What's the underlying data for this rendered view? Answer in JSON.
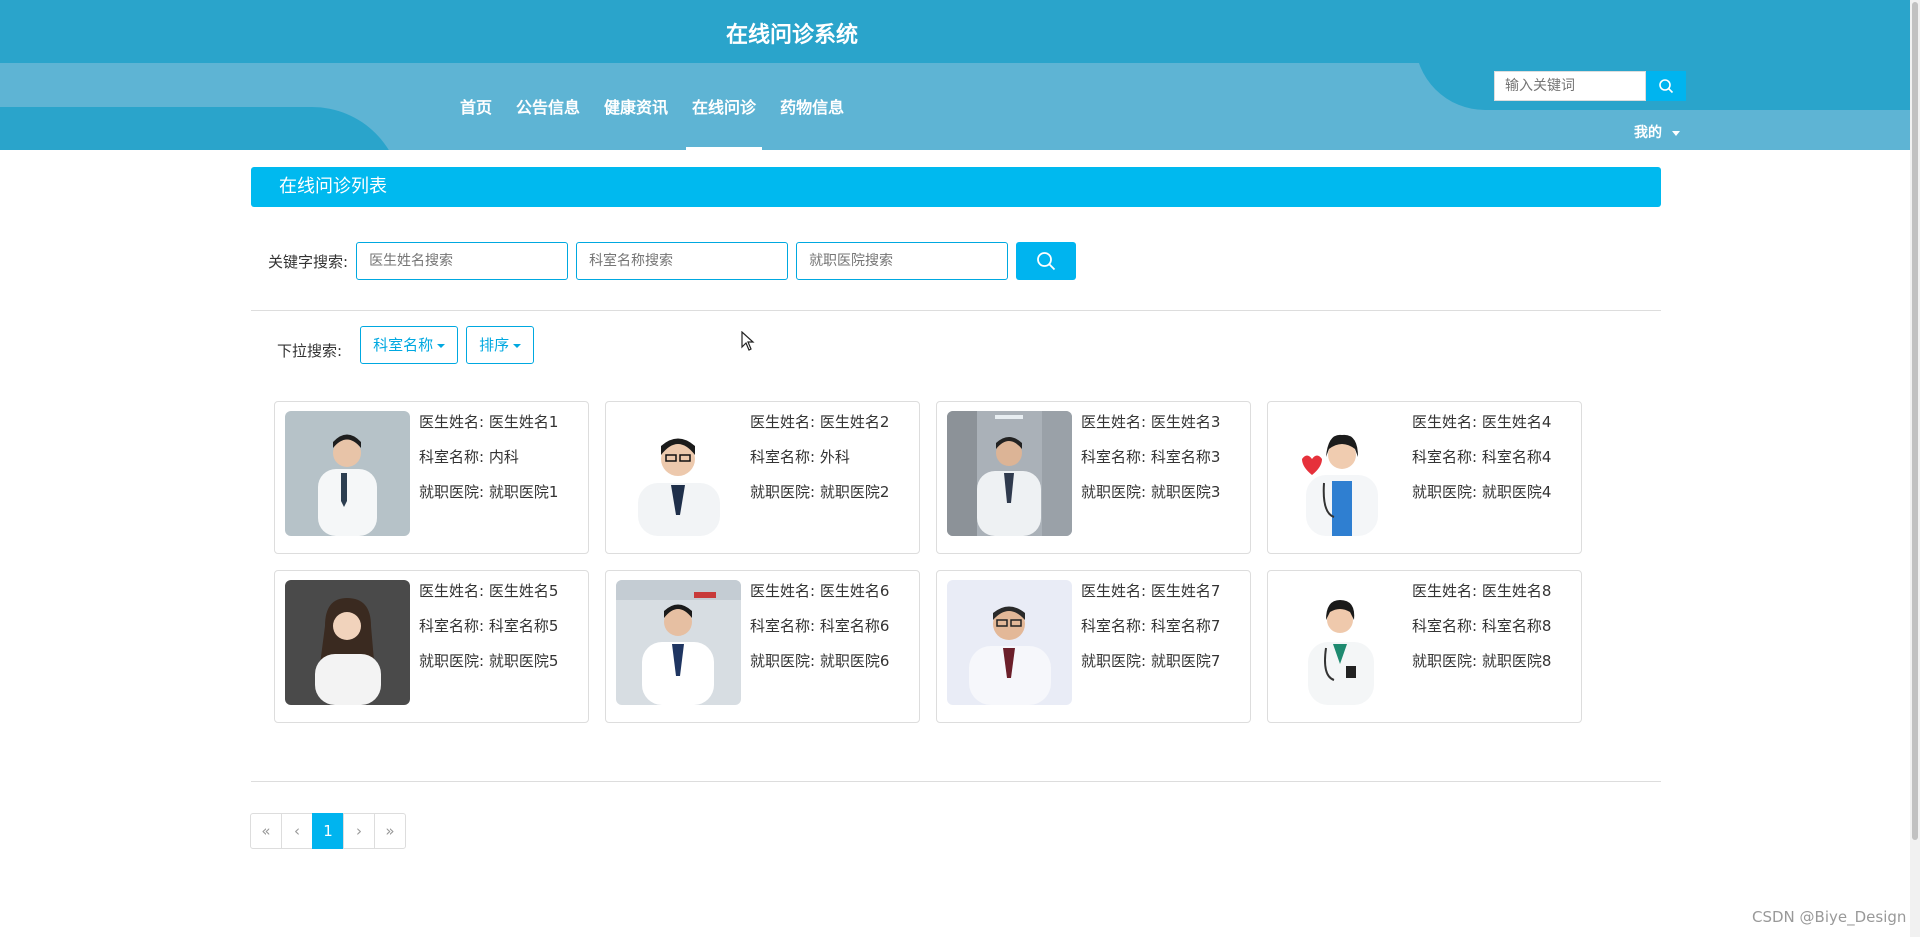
{
  "header": {
    "title": "在线问诊系统",
    "nav": [
      "首页",
      "公告信息",
      "健康资讯",
      "在线问诊",
      "药物信息"
    ],
    "active_nav": "在线问诊",
    "search_placeholder": "输入关键词",
    "user_menu": "我的"
  },
  "panel": {
    "title": "在线问诊列表"
  },
  "keyword_search": {
    "label": "关键字搜索:",
    "doctor_placeholder": "医生姓名搜索",
    "department_placeholder": "科室名称搜索",
    "hospital_placeholder": "就职医院搜索"
  },
  "dropdown_search": {
    "label": "下拉搜索:",
    "department_dropdown": "科室名称",
    "sort_dropdown": "排序"
  },
  "doctors": [
    {
      "name_label": "医生姓名:",
      "name": "医生姓名1",
      "dept_label": "科室名称:",
      "dept": "内科",
      "hosp_label": "就职医院:",
      "hosp": "就职医院1"
    },
    {
      "name_label": "医生姓名:",
      "name": "医生姓名2",
      "dept_label": "科室名称:",
      "dept": "外科",
      "hosp_label": "就职医院:",
      "hosp": "就职医院2"
    },
    {
      "name_label": "医生姓名:",
      "name": "医生姓名3",
      "dept_label": "科室名称:",
      "dept": "科室名称3",
      "hosp_label": "就职医院:",
      "hosp": "就职医院3"
    },
    {
      "name_label": "医生姓名:",
      "name": "医生姓名4",
      "dept_label": "科室名称:",
      "dept": "科室名称4",
      "hosp_label": "就职医院:",
      "hosp": "就职医院4"
    },
    {
      "name_label": "医生姓名:",
      "name": "医生姓名5",
      "dept_label": "科室名称:",
      "dept": "科室名称5",
      "hosp_label": "就职医院:",
      "hosp": "就职医院5"
    },
    {
      "name_label": "医生姓名:",
      "name": "医生姓名6",
      "dept_label": "科室名称:",
      "dept": "科室名称6",
      "hosp_label": "就职医院:",
      "hosp": "就职医院6"
    },
    {
      "name_label": "医生姓名:",
      "name": "医生姓名7",
      "dept_label": "科室名称:",
      "dept": "科室名称7",
      "hosp_label": "就职医院:",
      "hosp": "就职医院7"
    },
    {
      "name_label": "医生姓名:",
      "name": "医生姓名8",
      "dept_label": "科室名称:",
      "dept": "科室名称8",
      "hosp_label": "就职医院:",
      "hosp": "就职医院8"
    }
  ],
  "pagination": {
    "first": "«",
    "prev": "‹",
    "current": "1",
    "next": "›",
    "last": "»"
  },
  "watermark": "CSDN @Biye_Design",
  "colors": {
    "header_dark": "#2aa4cb",
    "header_light": "#5eb4d4",
    "accent": "#00b4ef"
  },
  "icons": {
    "search": "search-icon",
    "caret": "caret-down-icon",
    "cursor": "mouse-cursor-icon"
  }
}
